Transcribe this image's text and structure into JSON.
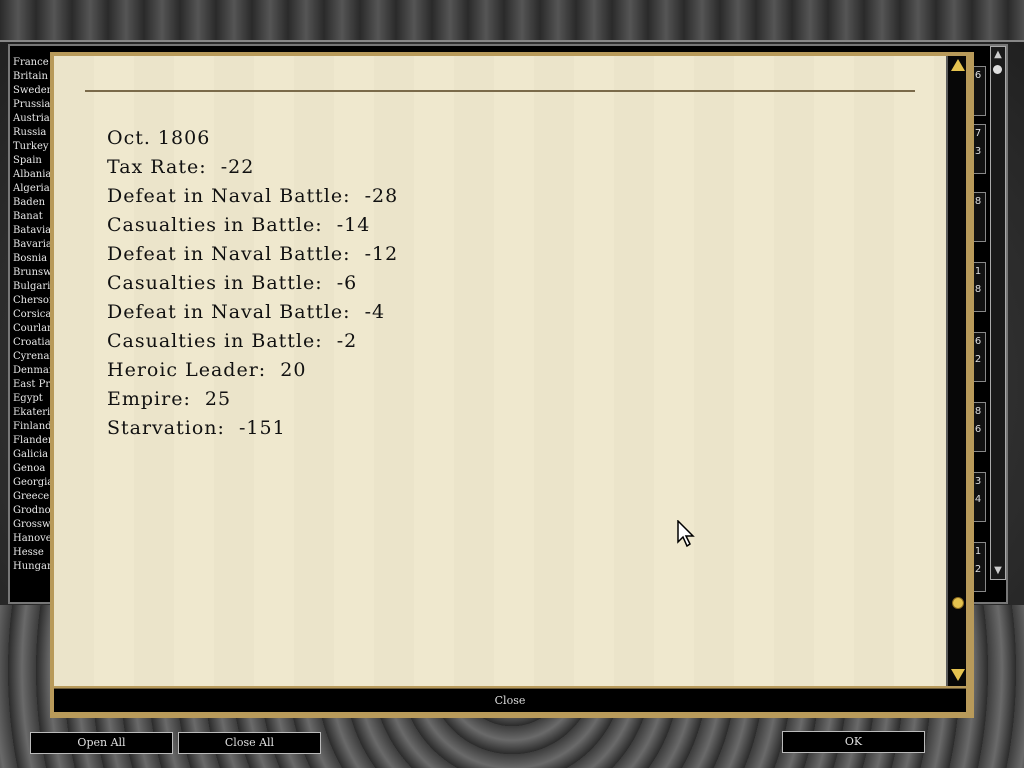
{
  "nations": [
    "France",
    "Britain",
    "Sweden",
    "Prussia",
    "Austria",
    "Russia",
    "Turkey",
    "Spain",
    "Albania",
    "Algeria",
    "Baden",
    "Banat",
    "Batavia",
    "Bavaria",
    "Bosnia",
    "Brunswick",
    "Bulgaria",
    "Cherson",
    "Corsica",
    "Courland",
    "Croatia",
    "Cyrenaica",
    "Denmark",
    "East Prussia",
    "Egypt",
    "Ekaterinoslav",
    "Finland",
    "Flanders",
    "Galicia",
    "Genoa",
    "Georgia",
    "Greece",
    "Grodno",
    "Grosswardein",
    "Hanover",
    "Hesse",
    "Hungary"
  ],
  "right_column": [
    {
      "a": "6",
      "b": ""
    },
    {
      "a": "7",
      "b": "3"
    },
    {
      "a": "8",
      "b": ""
    },
    {
      "a": "1",
      "b": "8"
    },
    {
      "a": "6",
      "b": "2"
    },
    {
      "a": "8",
      "b": "6"
    },
    {
      "a": "3",
      "b": "4"
    },
    {
      "a": "1",
      "b": "2"
    }
  ],
  "report": {
    "date": "Oct. 1806",
    "lines": [
      "Tax Rate:  -22",
      "Defeat in Naval Battle:  -28",
      "Casualties in Battle:  -14",
      "Defeat in Naval Battle:  -12",
      "Casualties in Battle:  -6",
      "Defeat in Naval Battle:  -4",
      "Casualties in Battle:  -2",
      "Heroic Leader:  20",
      "Empire:  25",
      "Starvation:  -151"
    ]
  },
  "dialog": {
    "close_label": "Close"
  },
  "buttons": {
    "open_all": "Open All",
    "close_all": "Close All",
    "ok": "OK"
  },
  "icons": {
    "scroll_up": "triangle-up-icon",
    "scroll_down": "triangle-down-icon",
    "cursor": "mouse-pointer-icon"
  },
  "colors": {
    "paper": "#efe8cd",
    "dialog_border": "#b89a5a",
    "scroll_accent": "#e5c34f",
    "text": "#111111"
  }
}
